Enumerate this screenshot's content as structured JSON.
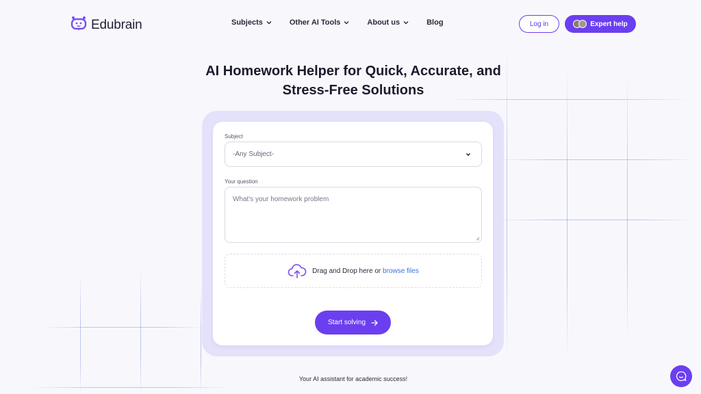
{
  "brand": {
    "name": "Edubrain",
    "accent": "#6b3ff0"
  },
  "nav": {
    "items": [
      {
        "label": "Subjects",
        "has_dropdown": true
      },
      {
        "label": "Other AI Tools",
        "has_dropdown": true
      },
      {
        "label": "About us",
        "has_dropdown": true
      },
      {
        "label": "Blog",
        "has_dropdown": false
      }
    ],
    "login_label": "Log in",
    "expert_label": "Expert help"
  },
  "hero": {
    "title_line1": "AI Homework Helper for Quick, Accurate, and",
    "title_line2": "Stress-Free Solutions"
  },
  "form": {
    "subject_label": "Subject",
    "subject_value": "-Any Subject-",
    "question_label": "Your question",
    "question_placeholder": "What's your homework problem",
    "drop_text": "Drag and Drop here or",
    "drop_link": "browse files",
    "submit_label": "Start solving"
  },
  "footer": {
    "tagline": "Your AI assistant for academic success!"
  },
  "icons": {
    "logo": "edubrain-logo-icon",
    "chevron": "chevron-down-icon",
    "upload": "cloud-upload-icon",
    "arrow": "arrow-right-icon",
    "chat": "chat-icon"
  }
}
